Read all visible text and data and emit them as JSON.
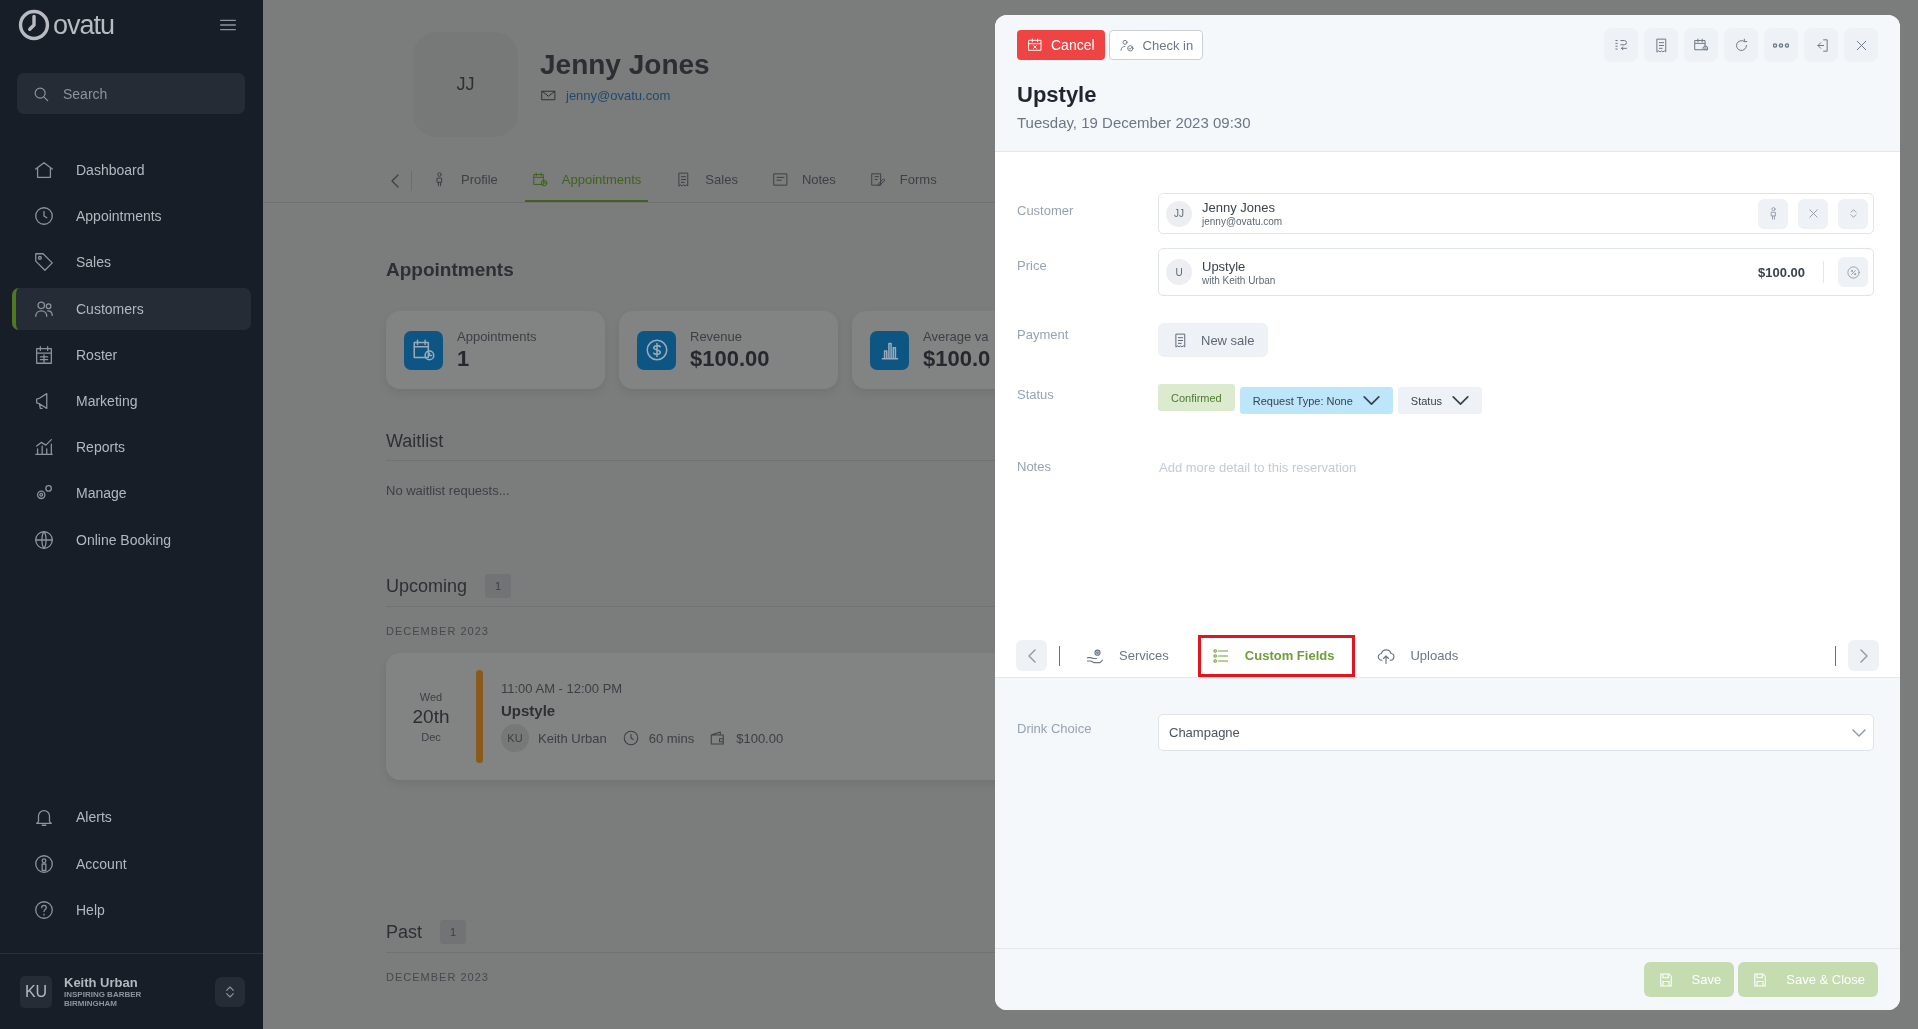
{
  "sidebar": {
    "logo": "ovatu",
    "search_placeholder": "Search",
    "items": [
      {
        "label": "Dashboard",
        "selected": false
      },
      {
        "label": "Appointments",
        "selected": false
      },
      {
        "label": "Sales",
        "selected": false
      },
      {
        "label": "Customers",
        "selected": true
      },
      {
        "label": "Roster",
        "selected": false
      },
      {
        "label": "Marketing",
        "selected": false
      },
      {
        "label": "Reports",
        "selected": false
      },
      {
        "label": "Manage",
        "selected": false
      },
      {
        "label": "Online Booking",
        "selected": false
      }
    ],
    "bottom_items": [
      {
        "label": "Alerts"
      },
      {
        "label": "Account"
      },
      {
        "label": "Help"
      }
    ],
    "user": {
      "initials": "KU",
      "name": "Keith Urban",
      "business": "INSPIRING BARBER",
      "location": "BIRMINGHAM"
    }
  },
  "customer": {
    "initials": "JJ",
    "name": "Jenny Jones",
    "email": "jenny@ovatu.com"
  },
  "profile_tabs": [
    {
      "label": "Profile",
      "selected": false
    },
    {
      "label": "Appointments",
      "selected": true
    },
    {
      "label": "Sales",
      "selected": false
    },
    {
      "label": "Notes",
      "selected": false
    },
    {
      "label": "Forms",
      "selected": false
    }
  ],
  "appointments_heading": "Appointments",
  "stats": [
    {
      "label": "Appointments",
      "value": "1"
    },
    {
      "label": "Revenue",
      "value": "$100.00"
    },
    {
      "label": "Average va",
      "value": "$100.0"
    }
  ],
  "waitlist": {
    "title": "Waitlist",
    "empty_text": "No waitlist requests..."
  },
  "upcoming": {
    "title": "Upcoming",
    "count": "1",
    "month": "DECEMBER 2023",
    "appointments": [
      {
        "weekday": "Wed",
        "day": "20th",
        "month": "Dec",
        "color": "#8a5a1c",
        "time": "11:00 AM - 12:00 PM",
        "service": "Upstyle",
        "staff_initials": "KU",
        "staff": "Keith Urban",
        "duration": "60 mins",
        "price": "$100.00"
      }
    ]
  },
  "past": {
    "title": "Past",
    "count": "1",
    "month": "DECEMBER 2023"
  },
  "booking": {
    "cancel_label": "Cancel",
    "checkin_label": "Check in",
    "title": "Upstyle",
    "datetime": "Tuesday, 19 December 2023 09:30",
    "customer_label": "Customer",
    "customer": {
      "initials": "JJ",
      "name": "Jenny Jones",
      "email": "jenny@ovatu.com"
    },
    "price_label": "Price",
    "service": {
      "initials": "U",
      "name": "Upstyle",
      "staff": "with Keith Urban",
      "price": "$100.00"
    },
    "payment_label": "Payment",
    "new_sale_label": "New sale",
    "status_label": "Status",
    "statuses": [
      {
        "kind": "tag",
        "label": "Confirmed",
        "color": "#dcebd0"
      },
      {
        "kind": "dropdown",
        "label": "Request Type: None",
        "color": "#bde6fb"
      },
      {
        "kind": "dropdown",
        "label": "Status",
        "color": "#eef2f6"
      }
    ],
    "notes_label": "Notes",
    "notes_placeholder": "Add more detail to this reservation",
    "tabs": [
      {
        "label": "Services",
        "selected": false,
        "highlighted": false
      },
      {
        "label": "Custom Fields",
        "selected": true,
        "highlighted": true
      },
      {
        "label": "Uploads",
        "selected": false,
        "highlighted": false
      }
    ],
    "custom_fields": [
      {
        "label": "Drink Choice",
        "value": "Champagne"
      }
    ],
    "footer_buttons": [
      {
        "label": "Save",
        "disabled": true
      },
      {
        "label": "Save & Close",
        "disabled": true
      }
    ]
  }
}
